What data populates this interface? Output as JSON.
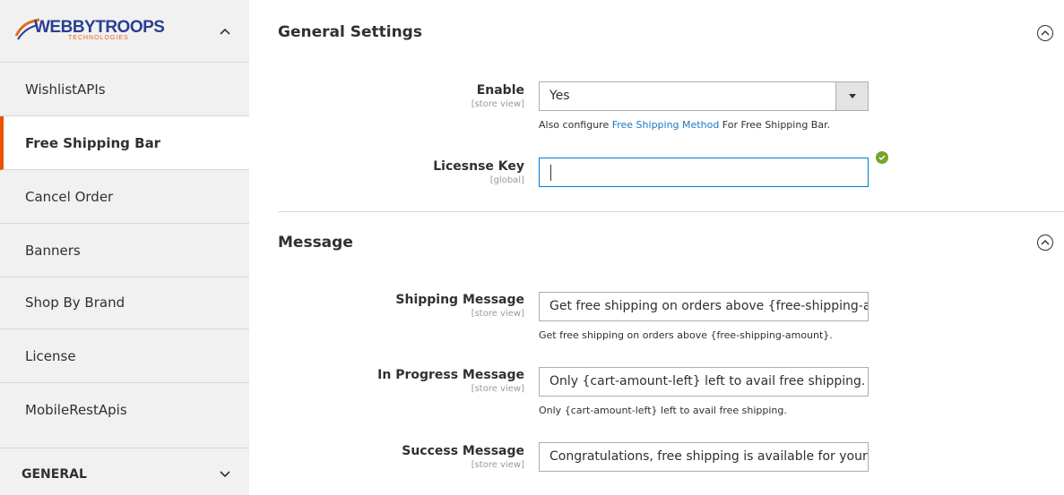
{
  "sidebar": {
    "logo_text": "WEBBYTROOPS",
    "logo_sub": "TECHNOLOGIES",
    "items": [
      {
        "label": "WishlistAPIs"
      },
      {
        "label": "Free Shipping Bar"
      },
      {
        "label": "Cancel Order"
      },
      {
        "label": "Banners"
      },
      {
        "label": "Shop By Brand"
      },
      {
        "label": "License"
      },
      {
        "label": "MobileRestApis"
      }
    ],
    "general_label": "GENERAL"
  },
  "general_settings": {
    "title": "General Settings",
    "enable": {
      "label": "Enable",
      "scope": "[store view]",
      "value": "Yes",
      "note_prefix": "Also configure ",
      "note_link": "Free Shipping Method",
      "note_suffix": " For Free Shipping Bar."
    },
    "license": {
      "label": "Licesnse Key",
      "scope": "[global]",
      "value": ""
    }
  },
  "message": {
    "title": "Message",
    "shipping": {
      "label": "Shipping Message",
      "scope": "[store view]",
      "value": "Get free shipping on orders above {free-shipping-a",
      "note": "Get free shipping on orders above {free-shipping-amount}."
    },
    "progress": {
      "label": "In Progress Message",
      "scope": "[store view]",
      "value": "Only {cart-amount-left} left to avail free shipping.",
      "note": "Only {cart-amount-left} left to avail free shipping."
    },
    "success": {
      "label": "Success Message",
      "scope": "[store view]",
      "value": "Congratulations, free shipping is available for your"
    }
  },
  "colors": {
    "accent": "#eb5202",
    "link": "#1979c3",
    "focus": "#007bdb",
    "valid": "#79a22e"
  }
}
